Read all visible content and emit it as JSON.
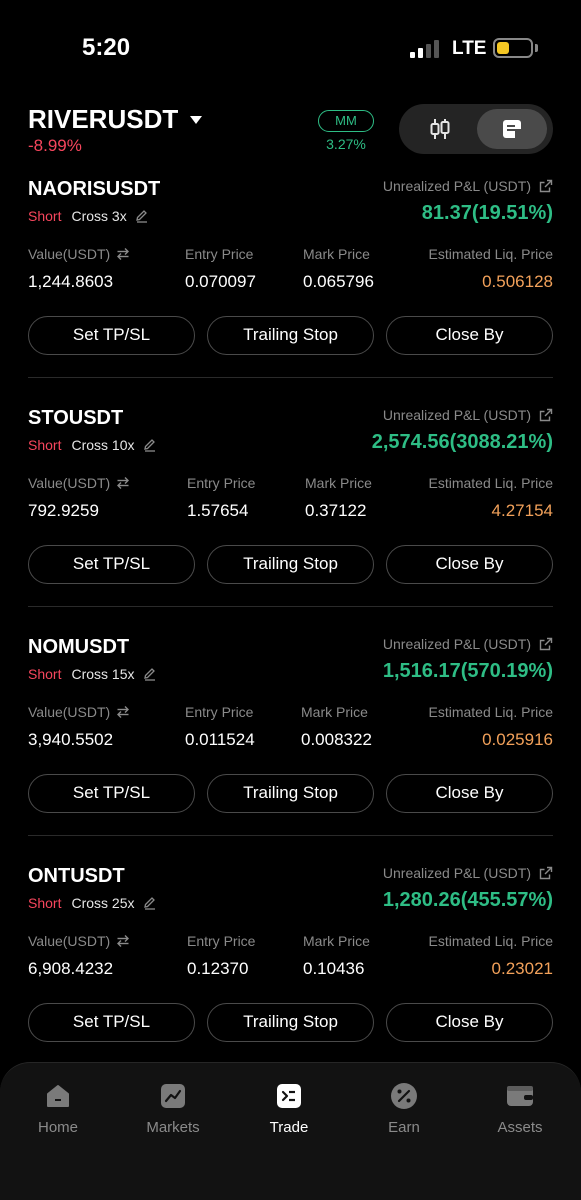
{
  "status_bar": {
    "time": "5:20",
    "network": "LTE"
  },
  "header": {
    "symbol": "RIVERUSDT",
    "change": "-8.99%",
    "mm_label": "MM",
    "mm_value": "3.27%"
  },
  "labels": {
    "pnl": "Unrealized P&L (USDT)",
    "value": "Value(USDT)",
    "entry": "Entry Price",
    "mark": "Mark Price",
    "liq": "Estimated Liq. Price",
    "set_tpsl": "Set TP/SL",
    "trailing_stop": "Trailing Stop",
    "close_by": "Close By"
  },
  "positions": [
    {
      "symbol": "NAORISUSDT",
      "side": "Short",
      "leverage": "Cross 3x",
      "pnl": "81.37(19.51%)",
      "value": "1,244.8603",
      "entry": "0.070097",
      "mark": "0.065796",
      "liq": "0.506128"
    },
    {
      "symbol": "STOUSDT",
      "side": "Short",
      "leverage": "Cross 10x",
      "pnl": "2,574.56(3088.21%)",
      "value": "792.9259",
      "entry": "1.57654",
      "mark": "0.37122",
      "liq": "4.27154"
    },
    {
      "symbol": "NOMUSDT",
      "side": "Short",
      "leverage": "Cross 15x",
      "pnl": "1,516.17(570.19%)",
      "value": "3,940.5502",
      "entry": "0.011524",
      "mark": "0.008322",
      "liq": "0.025916"
    },
    {
      "symbol": "ONTUSDT",
      "side": "Short",
      "leverage": "Cross 25x",
      "pnl": "1,280.26(455.57%)",
      "value": "6,908.4232",
      "entry": "0.12370",
      "mark": "0.10436",
      "liq": "0.23021"
    }
  ],
  "tabs": [
    {
      "label": "Home",
      "icon": "home-icon"
    },
    {
      "label": "Markets",
      "icon": "markets-icon"
    },
    {
      "label": "Trade",
      "icon": "trade-icon",
      "active": true
    },
    {
      "label": "Earn",
      "icon": "earn-icon"
    },
    {
      "label": "Assets",
      "icon": "wallet-icon"
    }
  ],
  "colors": {
    "up": "#2ebd85",
    "down": "#f6465d",
    "liq": "#f2a15a",
    "muted": "#8a8a8a"
  }
}
